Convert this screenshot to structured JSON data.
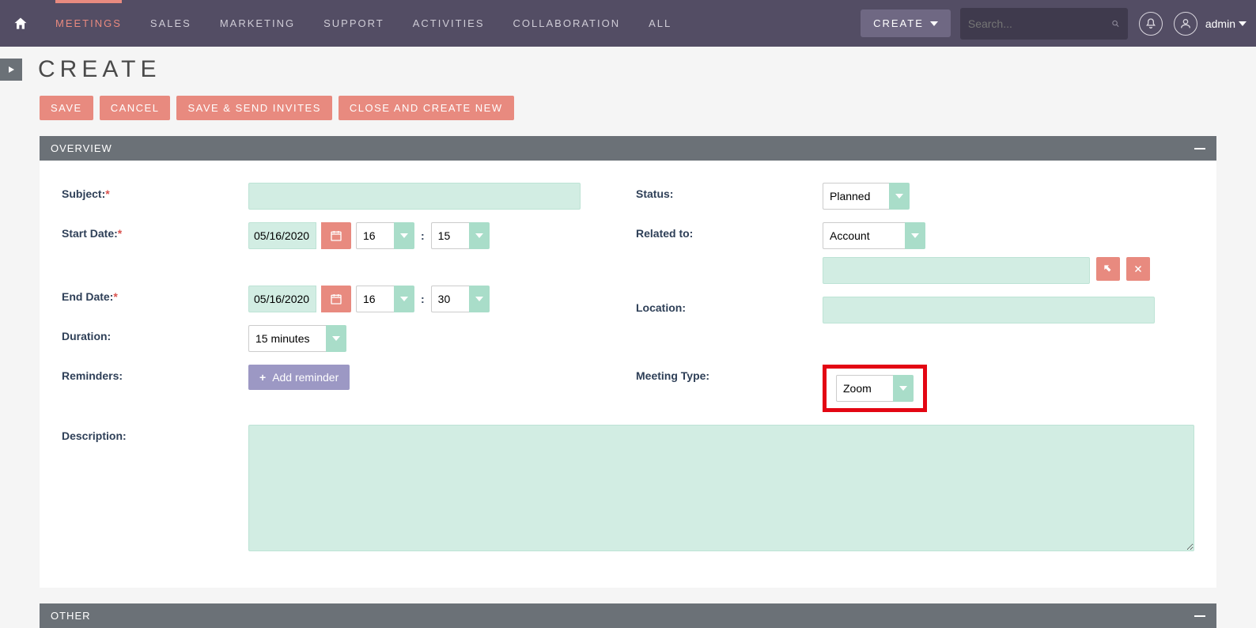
{
  "nav": {
    "items": [
      "MEETINGS",
      "SALES",
      "MARKETING",
      "SUPPORT",
      "ACTIVITIES",
      "COLLABORATION",
      "ALL"
    ],
    "active_index": 0
  },
  "header": {
    "create_btn": "CREATE",
    "search_placeholder": "Search...",
    "user": "admin"
  },
  "page": {
    "title": "CREATE"
  },
  "buttons": {
    "save": "SAVE",
    "cancel": "CANCEL",
    "save_send": "SAVE & SEND INVITES",
    "close_new": "CLOSE AND CREATE NEW"
  },
  "panels": {
    "overview": "OVERVIEW",
    "other": "OTHER"
  },
  "labels": {
    "subject": "Subject:",
    "start_date": "Start Date:",
    "end_date": "End Date:",
    "duration": "Duration:",
    "reminders": "Reminders:",
    "description": "Description:",
    "status": "Status:",
    "related_to": "Related to:",
    "location": "Location:",
    "meeting_type": "Meeting Type:",
    "add_reminder": "Add reminder"
  },
  "values": {
    "subject": "",
    "start_date": "05/16/2020",
    "start_hour": "16",
    "start_min": "15",
    "end_date": "05/16/2020",
    "end_hour": "16",
    "end_min": "30",
    "duration": "15 minutes",
    "status": "Planned",
    "related_to": "Account",
    "related_value": "",
    "location": "",
    "meeting_type": "Zoom",
    "description": ""
  }
}
